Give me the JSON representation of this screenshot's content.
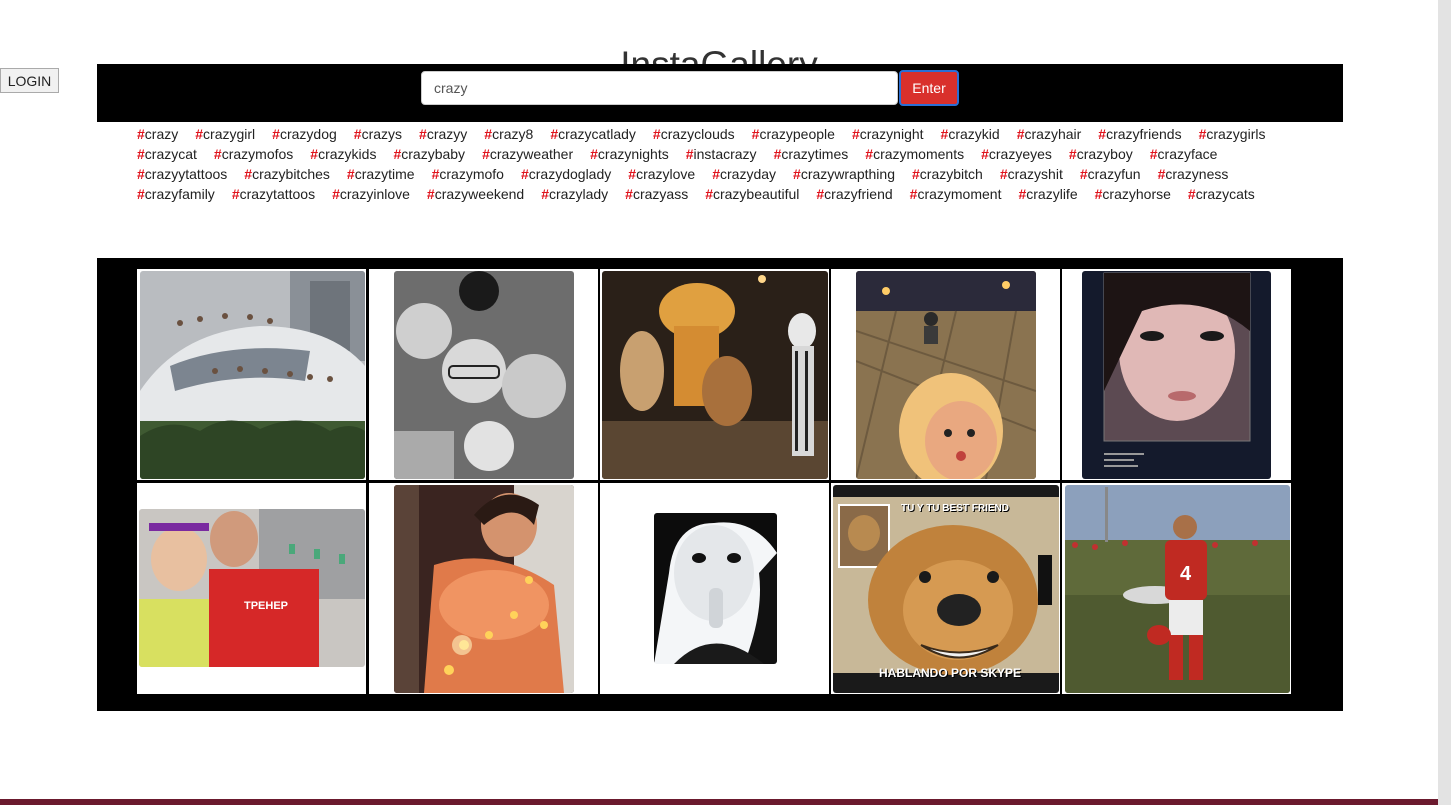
{
  "app": {
    "title": "InstaGallery"
  },
  "auth": {
    "login_label": "LOGIN"
  },
  "search": {
    "value": "crazy",
    "enter_label": "Enter"
  },
  "hashtags": [
    "crazy",
    "crazygirl",
    "crazydog",
    "crazys",
    "crazyy",
    "crazy8",
    "crazycatlady",
    "crazyclouds",
    "crazypeople",
    "crazynight",
    "crazykid",
    "crazyhair",
    "crazyfriends",
    "crazygirls",
    "crazycat",
    "crazymofos",
    "crazykids",
    "crazybaby",
    "crazyweather",
    "crazynights",
    "instacrazy",
    "crazytimes",
    "crazymoments",
    "crazyeyes",
    "crazyboy",
    "crazyface",
    "crazyytattoos",
    "crazybitches",
    "crazytime",
    "crazymofo",
    "crazydoglady",
    "crazylove",
    "crazyday",
    "crazywrapthing",
    "crazybitch",
    "crazyshit",
    "crazyfun",
    "crazyness",
    "crazyfamily",
    "crazytattoos",
    "crazyinlove",
    "crazyweekend",
    "crazylady",
    "crazyass",
    "crazybeautiful",
    "crazyfriend",
    "crazymoment",
    "crazylife",
    "crazyhorse",
    "crazycats"
  ],
  "gallery": {
    "photos": [
      {
        "subject": "birds on car"
      },
      {
        "subject": "family selfie black and white"
      },
      {
        "subject": "costumed bodybuilders"
      },
      {
        "subject": "selfie on street at night"
      },
      {
        "subject": "girl portrait with quote"
      },
      {
        "subject": "gym selfie"
      },
      {
        "subject": "woman with string lights"
      },
      {
        "subject": "girl black and white"
      },
      {
        "subject": "dog meme",
        "caption_top": "TU Y TU BEST FRIEND",
        "caption_bottom": "HABLANDO POR SKYPE"
      },
      {
        "subject": "football player on field"
      }
    ]
  },
  "colors": {
    "accent": "#d9302c",
    "hashtag": "#e0121b",
    "bar": "#000000",
    "footer": "#6b1a2e"
  }
}
